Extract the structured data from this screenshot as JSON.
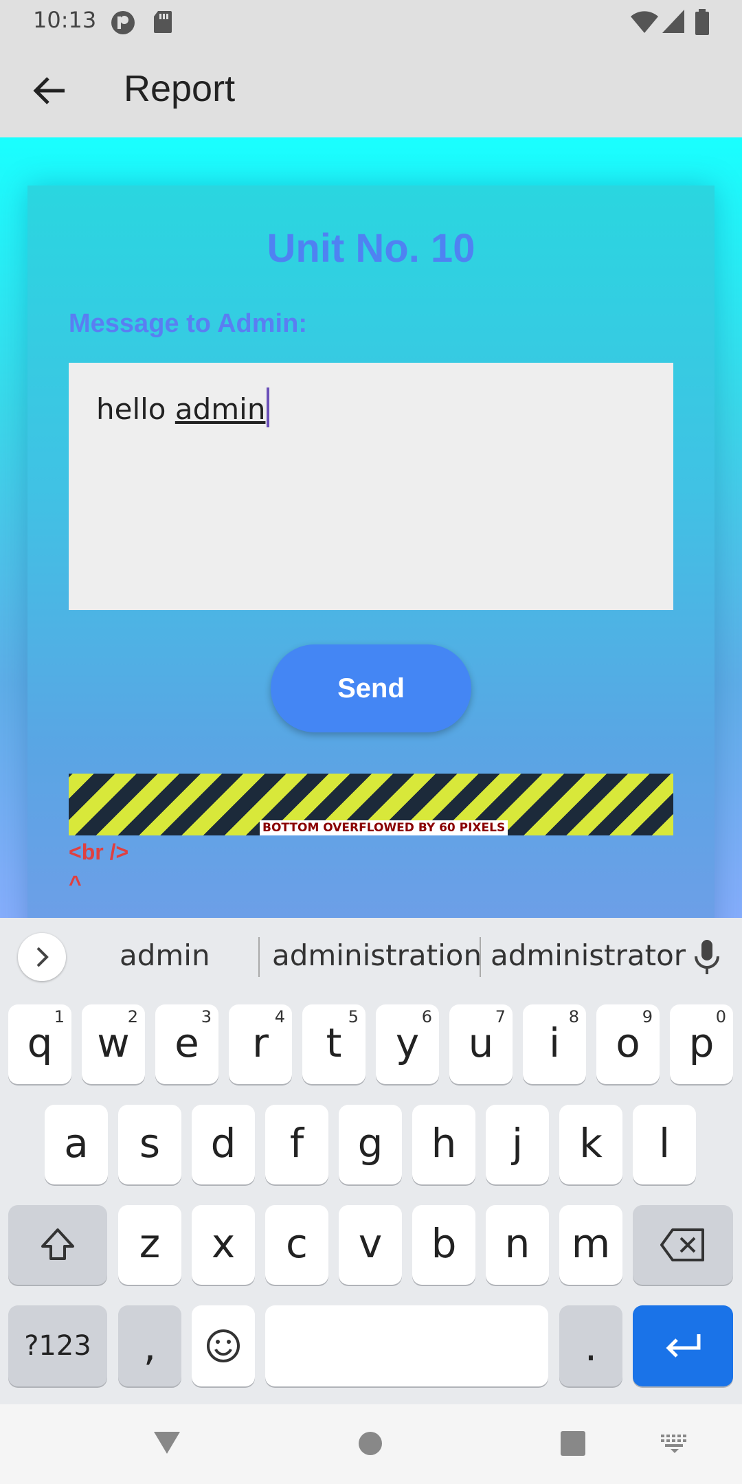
{
  "status_bar": {
    "time": "10:13",
    "icons": [
      "notification-app-icon",
      "sd-card-icon",
      "wifi-icon",
      "signal-icon",
      "battery-icon"
    ]
  },
  "app_bar": {
    "title": "Report",
    "back_icon": "arrow-left-icon"
  },
  "form": {
    "unit_title": "Unit No. 10",
    "message_label": "Message to Admin:",
    "message_value_plain": "hello ",
    "message_value_composing": "admin",
    "send_label": "Send"
  },
  "error": {
    "overflow_label": "BOTTOM OVERFLOWED BY 60 PIXELS",
    "line1": "<br />",
    "line2": "^"
  },
  "colors": {
    "accent": "#4486f4",
    "title": "#4f82f2",
    "error": "#e04040"
  },
  "keyboard": {
    "suggestions": [
      "admin",
      "administration",
      "administrator"
    ],
    "row1": [
      {
        "k": "q",
        "h": "1"
      },
      {
        "k": "w",
        "h": "2"
      },
      {
        "k": "e",
        "h": "3"
      },
      {
        "k": "r",
        "h": "4"
      },
      {
        "k": "t",
        "h": "5"
      },
      {
        "k": "y",
        "h": "6"
      },
      {
        "k": "u",
        "h": "7"
      },
      {
        "k": "i",
        "h": "8"
      },
      {
        "k": "o",
        "h": "9"
      },
      {
        "k": "p",
        "h": "0"
      }
    ],
    "row2": [
      "a",
      "s",
      "d",
      "f",
      "g",
      "h",
      "j",
      "k",
      "l"
    ],
    "row3": [
      "z",
      "x",
      "c",
      "v",
      "b",
      "n",
      "m"
    ],
    "symbols_label": "?123",
    "comma_label": ",",
    "period_label": "."
  }
}
